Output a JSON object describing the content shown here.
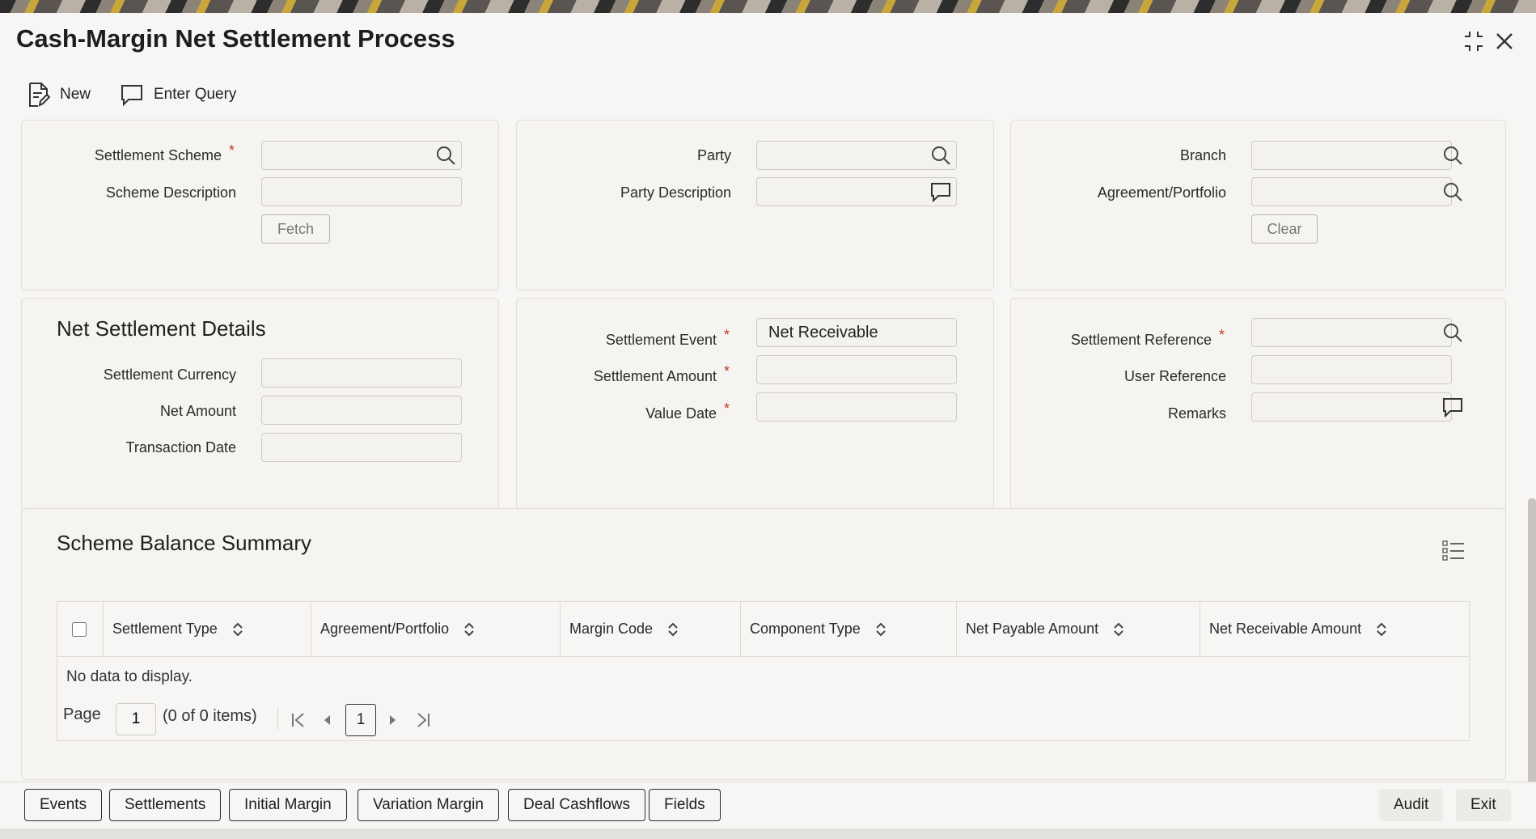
{
  "window": {
    "title": "Cash-Margin Net Settlement Process"
  },
  "toolbar": {
    "new_label": "New",
    "enter_query_label": "Enter Query"
  },
  "header_panel": {
    "settlement_scheme_label": "Settlement Scheme",
    "settlement_scheme_value": "",
    "scheme_description_label": "Scheme Description",
    "scheme_description_value": "",
    "fetch_label": "Fetch",
    "party_label": "Party",
    "party_value": "",
    "party_description_label": "Party Description",
    "party_description_value": "",
    "branch_label": "Branch",
    "branch_value": "",
    "agreement_label": "Agreement/Portfolio",
    "agreement_value": "",
    "clear_label": "Clear",
    "required_mark": "*"
  },
  "details": {
    "section_title": "Net Settlement Details",
    "settlement_currency_label": "Settlement Currency",
    "settlement_currency_value": "",
    "net_amount_label": "Net Amount",
    "net_amount_value": "",
    "transaction_date_label": "Transaction Date",
    "transaction_date_value": "",
    "settlement_event_label": "Settlement Event",
    "settlement_event_value": "Net Receivable",
    "settlement_amount_label": "Settlement Amount",
    "settlement_amount_value": "",
    "value_date_label": "Value Date",
    "value_date_value": "",
    "settlement_reference_label": "Settlement Reference",
    "settlement_reference_value": "",
    "user_reference_label": "User Reference",
    "user_reference_value": "",
    "remarks_label": "Remarks",
    "remarks_value": ""
  },
  "summary": {
    "section_title": "Scheme Balance Summary",
    "columns": [
      "Settlement Type",
      "Agreement/Portfolio",
      "Margin Code",
      "Component Type",
      "Net Payable Amount",
      "Net Receivable Amount"
    ],
    "empty_message": "No data to display.",
    "pagination": {
      "page_label": "Page",
      "page_value": "1",
      "items_text": "(0 of 0 items)",
      "current_page": "1"
    }
  },
  "footer": {
    "buttons": [
      "Events",
      "Settlements",
      "Initial Margin",
      "Variation Margin",
      "Deal Cashflows",
      "Fields"
    ],
    "audit_label": "Audit",
    "exit_label": "Exit"
  }
}
